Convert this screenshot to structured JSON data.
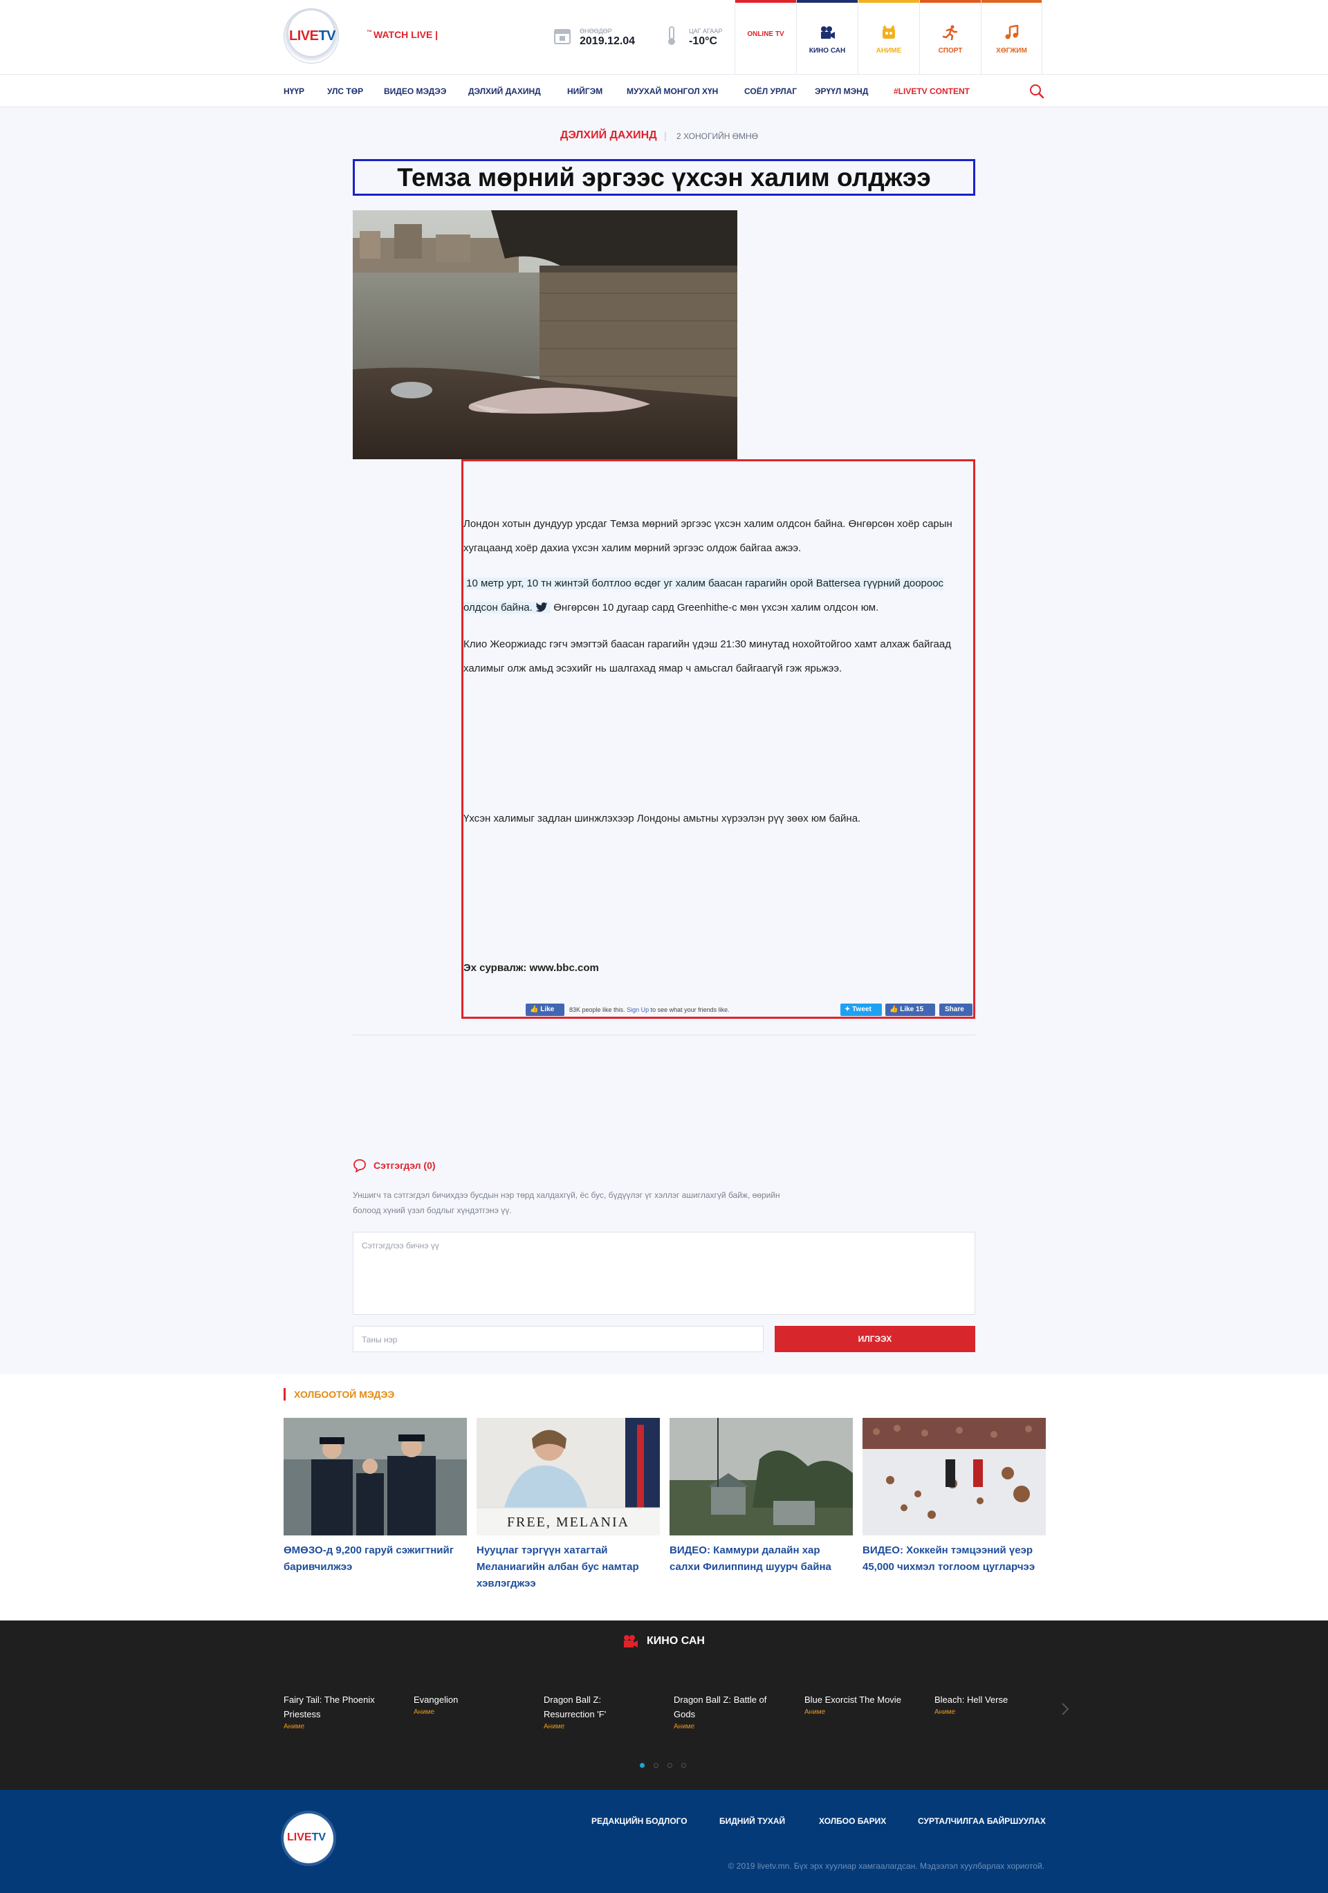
{
  "header": {
    "logo_text": "LIVETV",
    "watch_live": "WATCH LIVE |",
    "watch_tm": "™",
    "date_label": "ӨНӨӨДӨР",
    "date_value": "2019.12.04",
    "weather_label": "ЦАГ АГААР",
    "weather_value": "-10°C",
    "top_nav": [
      {
        "label": "ONLINE TV",
        "color": "#e0232b"
      },
      {
        "label": "КИНО САН",
        "color": "#1d2f6f"
      },
      {
        "label": "АНИМЕ",
        "color": "#f2b01e"
      },
      {
        "label": "СПОРТ",
        "color": "#e05a1f"
      },
      {
        "label": "ХӨГЖИМ",
        "color": "#e0661f"
      }
    ]
  },
  "menu": [
    "НҮҮР",
    "УЛС ТӨР",
    "ВИДЕО МЭДЭЭ",
    "ДЭЛХИЙ ДАХИНД",
    "НИЙГЭМ",
    "МУУХАЙ МОНГОЛ ХҮН",
    "СОЁЛ УРЛАГ",
    "ЭРҮҮЛ МЭНД",
    "#LIVETV CONTENT"
  ],
  "article": {
    "category": "ДЭЛХИЙ ДАХИНД",
    "separator": "|",
    "time_ago": "2 ХОНОГИЙН ӨМНӨ",
    "title": "Темза мөрний эргээс үхсэн халим олджээ",
    "p1": "Лондон хотын дундуур урсдаг Темза мөрний эргээс үхсэн халим олдсон байна. Өнгөрсөн хоёр сарын хугацаанд хоёр дахиа үхсэн халим мөрний эргээс олдож байгаа ажээ.",
    "p2_highlight": "10 метр урт, 10 тн жинтэй болтлоо өсдөг уг халим баасан гарагийн орой Battersea гүүрний доороос олдсон байна.",
    "p2_rest": "Өнгөрсөн 10 дугаар сард Greenhithe-с мөн үхсэн халим олдсон юм.",
    "p3": "Клио Жеоржиадс гэгч эмэгтэй баасан гарагийн үдэш 21:30 минутад нохойтойгоо хамт алхаж байгаад халимыг олж амьд эсэхийг нь шалгахад ямар ч амьсгал байгаагүй гэж ярьжээ.",
    "p4": "Үхсэн халимыг задлан шинжлэхээр Лондоны амьтны хүрээлэн рүү зөөх юм байна.",
    "source": "Эх сурвалж: www.bbc.com"
  },
  "social": {
    "like": "Like",
    "like_text": "83K people like this.",
    "signup": "Sign Up",
    "signup_rest": "to see what your friends like.",
    "tweet": "Tweet",
    "like2": "Like 15",
    "share": "Share"
  },
  "comments": {
    "title": "Сэтгэгдэл (0)",
    "note": "Уншигч та сэтгэгдэл бичихдээ бусдын нэр төрд халдахгүй, ёс бус, бүдүүлэг үг хэллэг ашиглахгүй байж, өөрийн болоод хүний үзэл бодлыг хүндэтгэнэ үү.",
    "textarea_placeholder": "Сэтгэгдлээ бичнэ үү",
    "name_placeholder": "Таны нэр",
    "send": "ИЛГЭЭХ"
  },
  "related": {
    "title": "ХОЛБООТОЙ МЭДЭЭ",
    "items": [
      {
        "caption": "ӨМӨЗО-д 9,200 гаруй сэжигтнийг баривчилжээ"
      },
      {
        "caption": "Нууцлаг тэргүүн хатагтай Меланиагийн албан бус намтар хэвлэгджээ",
        "img_text": "FREE, MELANIA"
      },
      {
        "caption": "ВИДЕО: Каммури далайн хар салхи Филиппинд шуурч байна"
      },
      {
        "caption": "ВИДЕО: Хоккейн тэмцээний үеэр 45,000 чихмэл тоглоом цугларчээ"
      }
    ]
  },
  "kino": {
    "title": "КИНО САН",
    "movies": [
      {
        "name": "Fairy Tail: The Phoenix Priestess",
        "genre": "Аниме"
      },
      {
        "name": "Evangelion",
        "genre": "Аниме"
      },
      {
        "name": "Dragon Ball Z: Resurrection 'F'",
        "genre": "Аниме"
      },
      {
        "name": "Dragon Ball Z: Battle of Gods",
        "genre": "Аниме"
      },
      {
        "name": "Blue Exorcist The Movie",
        "genre": "Аниме"
      },
      {
        "name": "Bleach: Hell Verse",
        "genre": "Аниме"
      }
    ]
  },
  "footer": {
    "links": [
      "РЕДАКЦИЙН БОДЛОГО",
      "БИДНИЙ ТУХАЙ",
      "ХОЛБОО БАРИХ",
      "СУРТАЛЧИЛГАА БАЙРШУУЛАХ"
    ],
    "copyright": "© 2019 livetv.mn. Бүх эрх хуулиар хамгаалагдсан. Мэдээлэл хуулбарлах хориотой."
  }
}
